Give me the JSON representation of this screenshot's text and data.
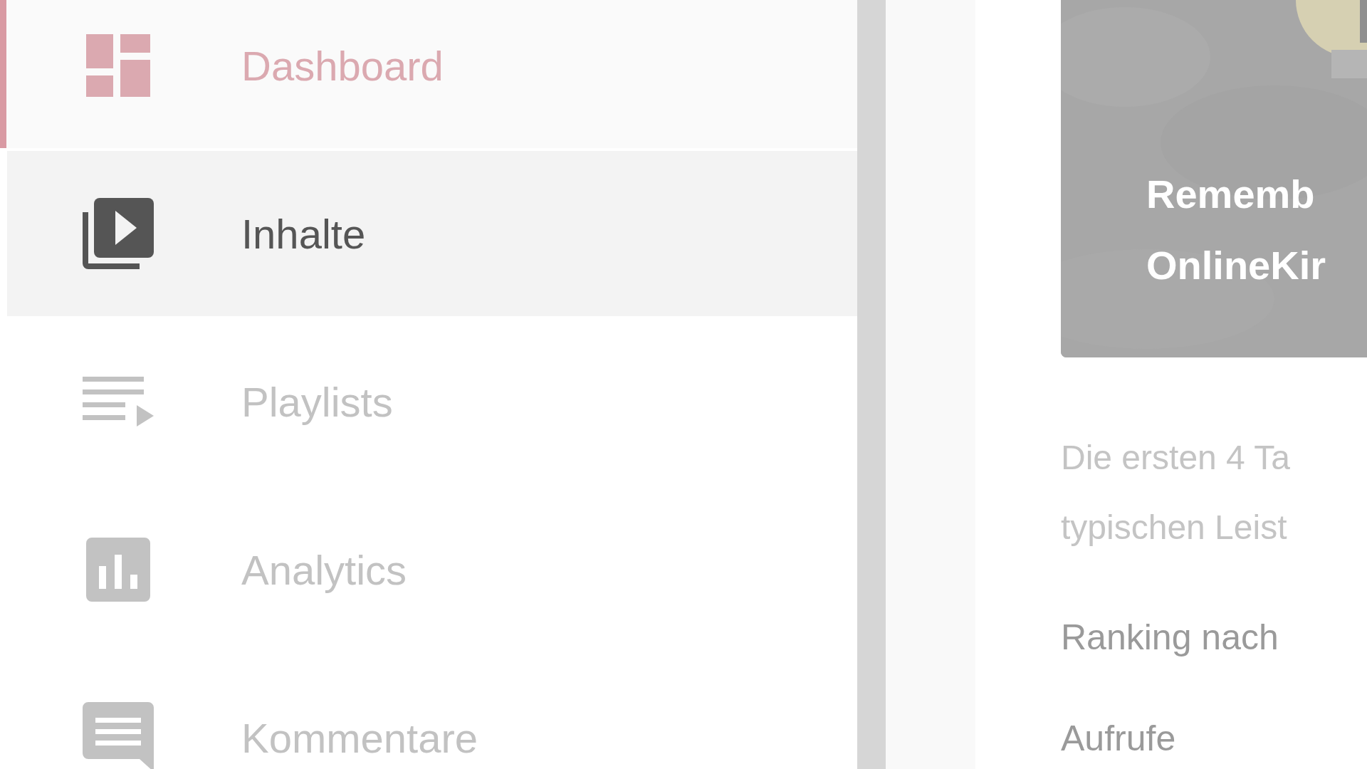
{
  "sidebar": {
    "items": [
      {
        "label": "Dashboard",
        "kind": "dashboard",
        "selected": true,
        "hovered": false
      },
      {
        "label": "Inhalte",
        "kind": "content",
        "selected": false,
        "hovered": true
      },
      {
        "label": "Playlists",
        "kind": "playlists",
        "selected": false,
        "hovered": false
      },
      {
        "label": "Analytics",
        "kind": "analytics",
        "selected": false,
        "hovered": false
      },
      {
        "label": "Kommentare",
        "kind": "comments",
        "selected": false,
        "hovered": false
      }
    ]
  },
  "video_card": {
    "thumbnail": {
      "kind": "picture",
      "title_lines": [
        "Rememb",
        "OnlineKir"
      ]
    },
    "description_lines": [
      "Die ersten 4 Ta",
      "typischen Leist"
    ],
    "ranking_label": "Ranking nach",
    "metric_label": "Aufrufe"
  }
}
